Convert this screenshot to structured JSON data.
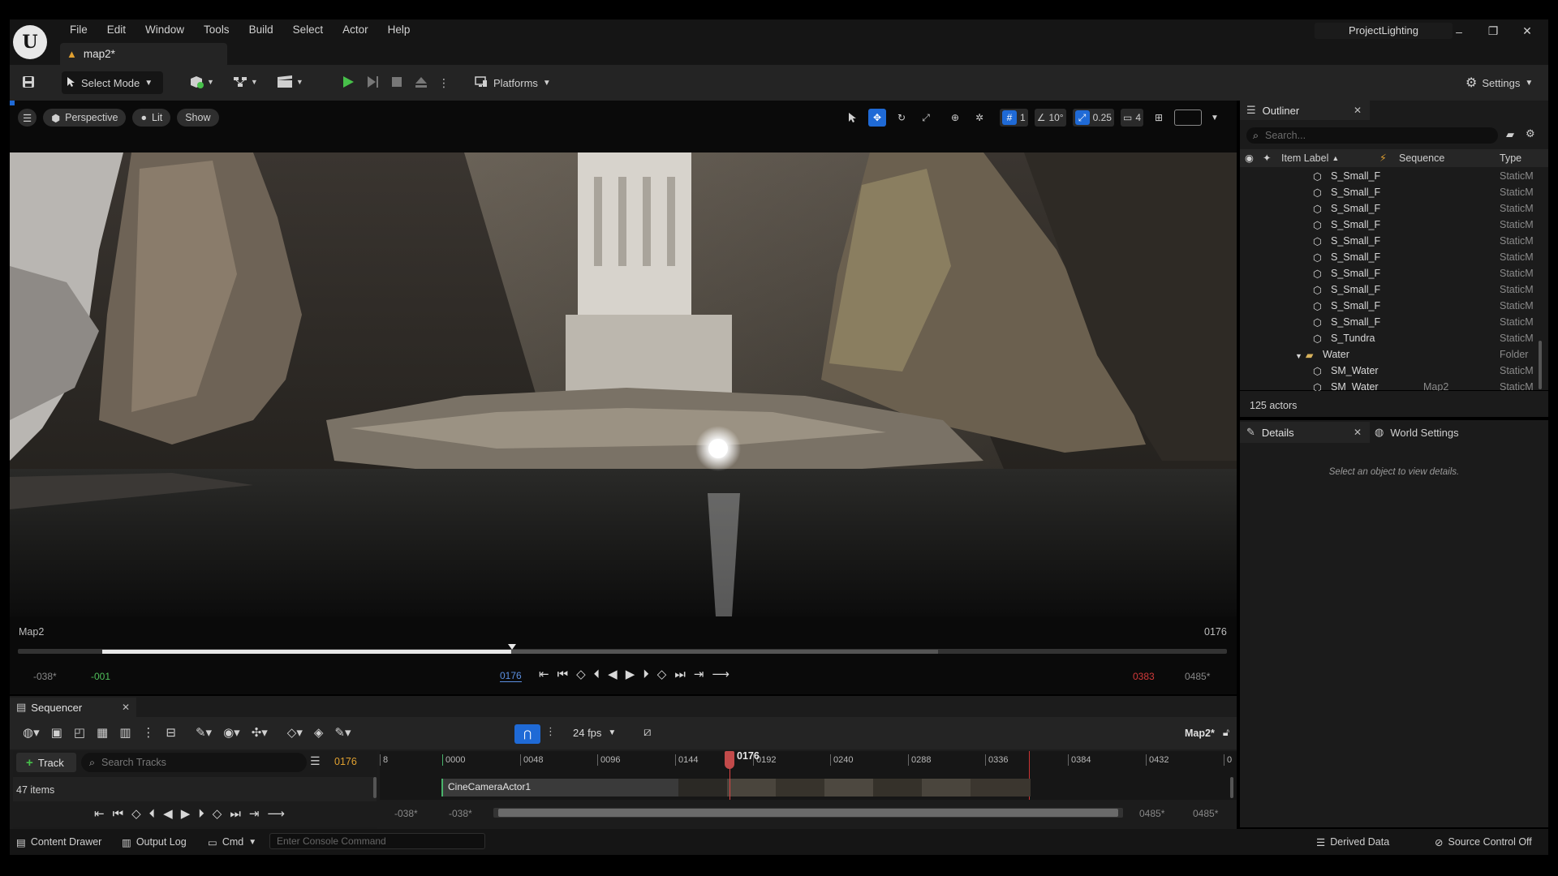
{
  "app": {
    "document_tab": "map2*",
    "project_name": "ProjectLighting"
  },
  "menu": [
    "File",
    "Edit",
    "Window",
    "Tools",
    "Build",
    "Select",
    "Actor",
    "Help"
  ],
  "toolbar": {
    "select_mode": "Select Mode",
    "platforms": "Platforms",
    "settings": "Settings"
  },
  "viewport": {
    "perspective": "Perspective",
    "lit": "Lit",
    "show": "Show",
    "grid_value": "1",
    "angle_value": "10°",
    "scale_value": "0.25",
    "camera_speed": "4",
    "map_label": "Map2",
    "current_frame": "0176",
    "start_in": "-038*",
    "start_frame": "-001",
    "current_frame_field": "0176",
    "end_frame": "0383",
    "end_out": "0485*"
  },
  "sequencer": {
    "tab_label": "Sequencer",
    "fps": "24 fps",
    "sequence_name": "Map2*",
    "track_button": "Track",
    "search_placeholder": "Search Tracks",
    "current_frame": "0176",
    "items_count": "47 items",
    "playhead_label": "0176",
    "ruler_ticks": [
      "8",
      "0000",
      "0048",
      "0096",
      "0144",
      "0192",
      "0240",
      "0288",
      "0336",
      "0384",
      "0432",
      "0"
    ],
    "camera_track": "CineCameraActor1",
    "range_start_a": "-038*",
    "range_start_b": "-038*",
    "range_end_a": "0485*",
    "range_end_b": "0485*"
  },
  "outliner": {
    "tab_label": "Outliner",
    "search_placeholder": "Search...",
    "col_item_label": "Item Label",
    "col_sequence": "Sequence",
    "col_type": "Type",
    "rows": [
      {
        "name": "S_Small_F",
        "sequence": "",
        "type": "StaticM"
      },
      {
        "name": "S_Small_F",
        "sequence": "",
        "type": "StaticM"
      },
      {
        "name": "S_Small_F",
        "sequence": "",
        "type": "StaticM"
      },
      {
        "name": "S_Small_F",
        "sequence": "",
        "type": "StaticM"
      },
      {
        "name": "S_Small_F",
        "sequence": "",
        "type": "StaticM"
      },
      {
        "name": "S_Small_F",
        "sequence": "",
        "type": "StaticM"
      },
      {
        "name": "S_Small_F",
        "sequence": "",
        "type": "StaticM"
      },
      {
        "name": "S_Small_F",
        "sequence": "",
        "type": "StaticM"
      },
      {
        "name": "S_Small_F",
        "sequence": "",
        "type": "StaticM"
      },
      {
        "name": "S_Small_F",
        "sequence": "",
        "type": "StaticM"
      },
      {
        "name": "S_Tundra",
        "sequence": "",
        "type": "StaticM"
      },
      {
        "name": "Water",
        "sequence": "",
        "type": "Folder"
      },
      {
        "name": "SM_Water",
        "sequence": "",
        "type": "StaticM"
      },
      {
        "name": "SM_Water",
        "sequence": "Map2",
        "type": "StaticM"
      }
    ],
    "actor_count": "125 actors"
  },
  "details": {
    "tab_label": "Details",
    "world_settings_label": "World Settings",
    "empty_message": "Select an object to view details."
  },
  "statusbar": {
    "content_drawer": "Content Drawer",
    "output_log": "Output Log",
    "cmd": "Cmd",
    "console_placeholder": "Enter Console Command",
    "derived_data": "Derived Data",
    "source_control": "Source Control Off"
  },
  "colors": {
    "accent_blue": "#1f6ad6",
    "play_green": "#47c04a",
    "playhead_red": "#c24a4a",
    "frame_orange": "#e0a030",
    "frame_red": "#d23a3a",
    "frame_green": "#4fbf5a",
    "frame_blue": "#5b8fe0"
  }
}
